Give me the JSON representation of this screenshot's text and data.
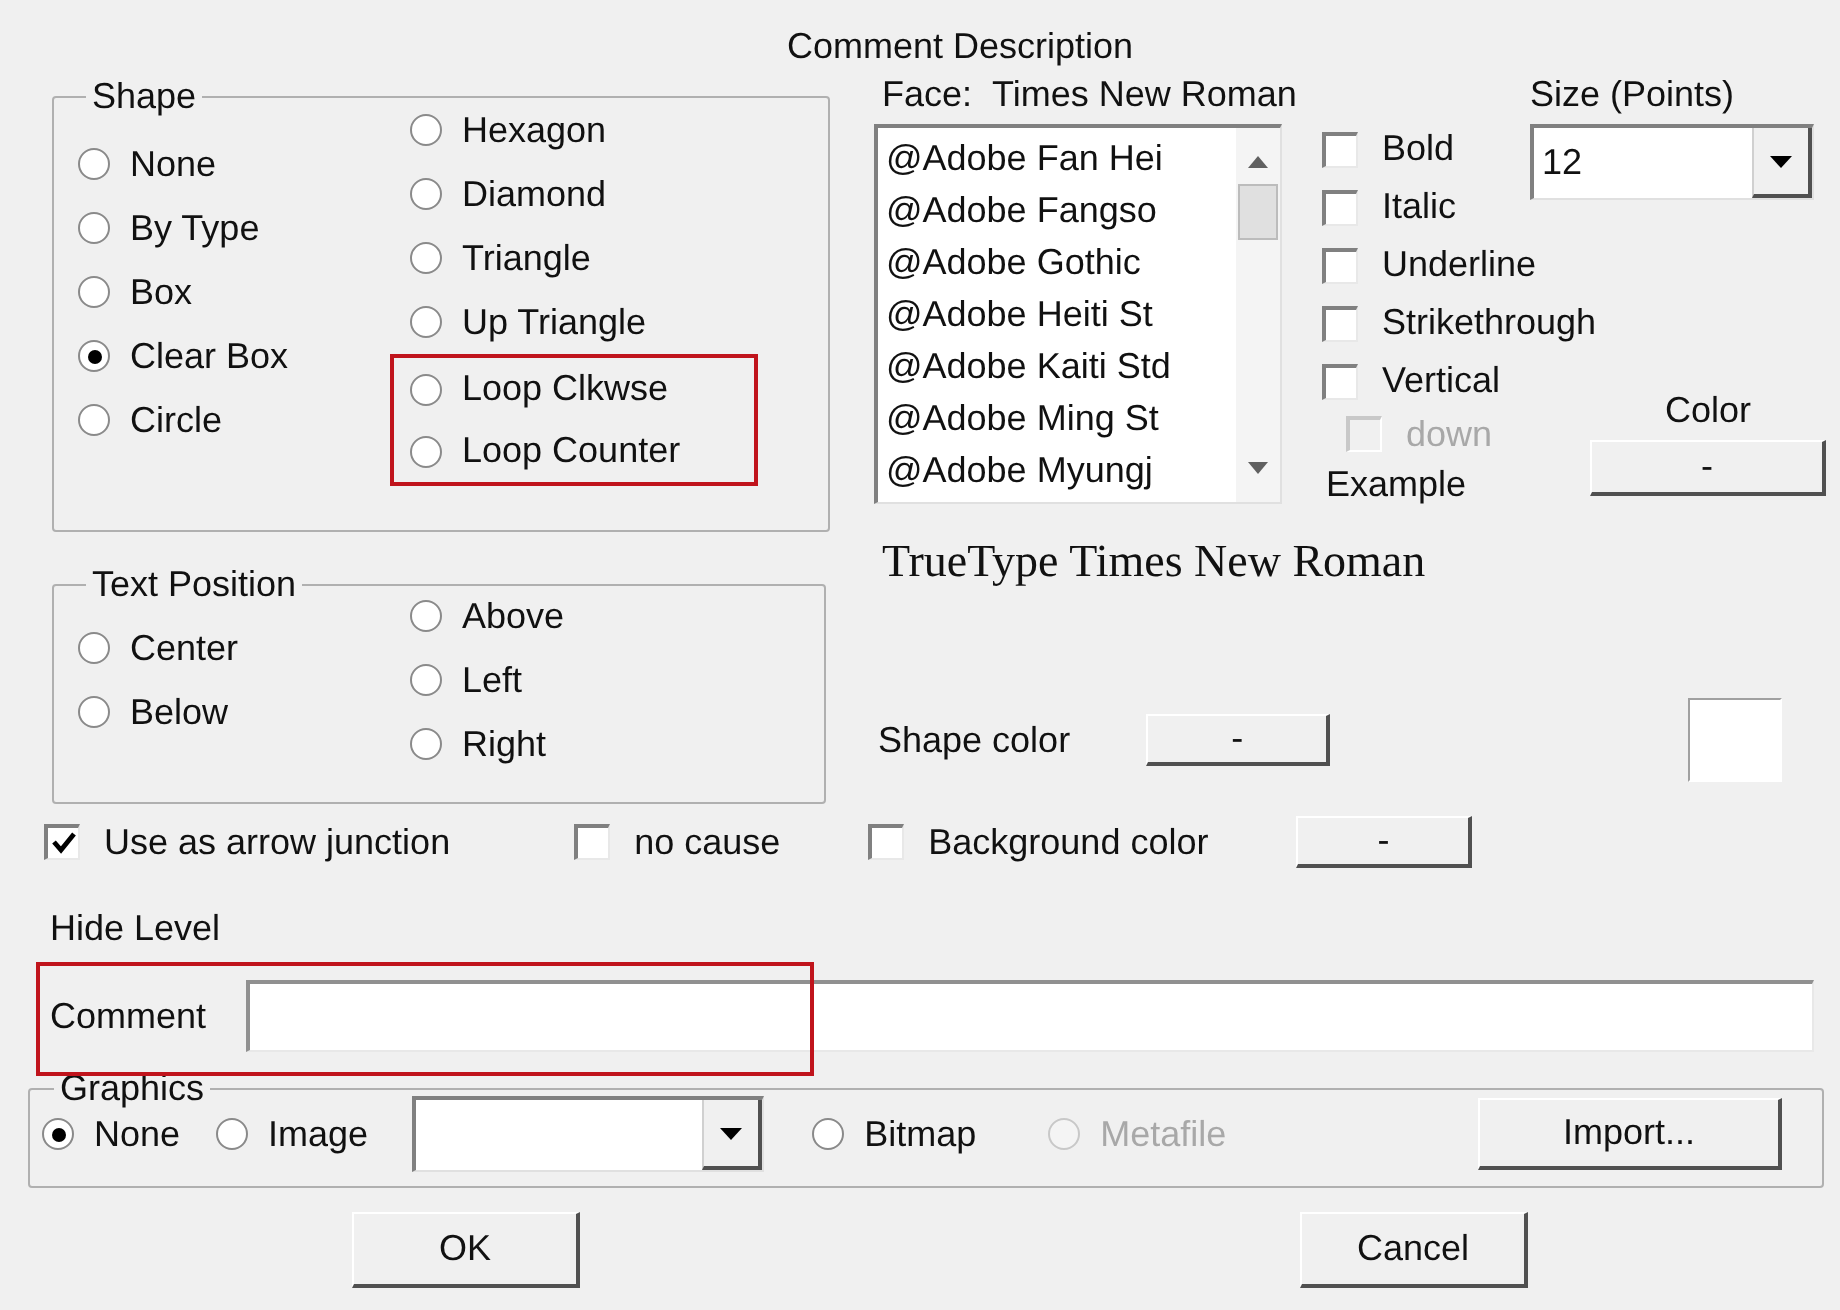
{
  "dialog": {
    "title": "Comment Description"
  },
  "shape": {
    "legend": "Shape",
    "columns": [
      [
        {
          "label": "None",
          "selected": false,
          "highlighted": false
        },
        {
          "label": "By Type",
          "selected": false,
          "highlighted": false
        },
        {
          "label": "Box",
          "selected": false,
          "highlighted": false
        },
        {
          "label": "Clear Box",
          "selected": true,
          "highlighted": false
        },
        {
          "label": "Circle",
          "selected": false,
          "highlighted": false
        }
      ],
      [
        {
          "label": "Hexagon",
          "selected": false,
          "highlighted": false
        },
        {
          "label": "Diamond",
          "selected": false,
          "highlighted": false
        },
        {
          "label": "Triangle",
          "selected": false,
          "highlighted": false
        },
        {
          "label": "Up Triangle",
          "selected": false,
          "highlighted": false
        },
        {
          "label": "Loop Clkwse",
          "selected": false,
          "highlighted": true
        },
        {
          "label": "Loop Counter",
          "selected": false,
          "highlighted": true
        }
      ]
    ]
  },
  "text_position": {
    "legend": "Text Position",
    "columns": [
      [
        {
          "label": "Center",
          "selected": false
        },
        {
          "label": "Below",
          "selected": false
        }
      ],
      [
        {
          "label": "Above",
          "selected": false
        },
        {
          "label": "Left",
          "selected": false
        },
        {
          "label": "Right",
          "selected": false
        }
      ]
    ]
  },
  "font": {
    "face_label": "Face:",
    "face_value": "Times New Roman",
    "fonts": [
      "@Adobe Fan Hei",
      "@Adobe Fangso",
      "@Adobe Gothic",
      "@Adobe Heiti St",
      "@Adobe Kaiti Std",
      "@Adobe Ming St",
      "@Adobe Myungj"
    ],
    "styles": [
      {
        "label": "Bold",
        "checked": false,
        "disabled": false
      },
      {
        "label": "Italic",
        "checked": false,
        "disabled": false
      },
      {
        "label": "Underline",
        "checked": false,
        "disabled": false
      },
      {
        "label": "Strikethrough",
        "checked": false,
        "disabled": false
      },
      {
        "label": "Vertical",
        "checked": false,
        "disabled": false
      },
      {
        "label": "down",
        "checked": false,
        "disabled": true
      }
    ],
    "example_label": "Example",
    "size_label": "Size (Points)",
    "size_value": "12",
    "color_label": "Color",
    "color_button": "-",
    "example_text": "TrueType Times New Roman"
  },
  "shape_color": {
    "label": "Shape color",
    "button": "-"
  },
  "options": [
    {
      "label": "Use as arrow junction",
      "checked": true
    },
    {
      "label": "no cause",
      "checked": false
    },
    {
      "label": "Background color",
      "checked": false
    }
  ],
  "background_color_button": "-",
  "hide_level_label": "Hide Level",
  "comment": {
    "label": "Comment",
    "highlighted": true
  },
  "graphics": {
    "legend": "Graphics",
    "sources": [
      {
        "label": "None",
        "selected": true,
        "disabled": false
      },
      {
        "label": "Image",
        "selected": false,
        "disabled": false
      }
    ],
    "formats": [
      {
        "label": "Bitmap",
        "selected": false,
        "disabled": false
      },
      {
        "label": "Metafile",
        "selected": false,
        "disabled": true
      }
    ],
    "import_button": "Import..."
  },
  "buttons": [
    "OK",
    "Cancel"
  ]
}
